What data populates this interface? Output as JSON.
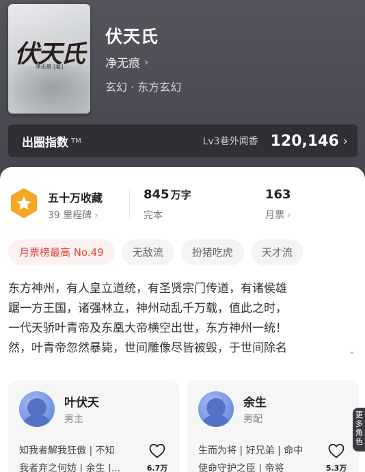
{
  "book": {
    "cover_title": "伏天氏",
    "cover_author": "净无痕 [著]",
    "title": "伏天氏",
    "author": "净无痕",
    "genre": "玄幻 · 东方玄幻"
  },
  "index_bar": {
    "label": "出圈指数",
    "tm": "TM",
    "level": "Lv3巷外闻香",
    "value": "120,146"
  },
  "stats": {
    "collection": {
      "title": "五十万收藏",
      "sub": "39 里程碑"
    },
    "words": {
      "value": "845",
      "unit": "万字",
      "sub": "完本"
    },
    "monthly": {
      "value": "163",
      "sub": "月票"
    }
  },
  "tags": [
    "月票榜最高 No.49",
    "无敌流",
    "扮猪吃虎",
    "天才流"
  ],
  "synopsis": {
    "lines": [
      "东方神州，有人皇立道统，有圣贤宗门传道，有诸侯雄",
      "踞一方王国，诸强林立，神州动乱千万载，值此之时，",
      "一代天骄叶青帝及东凰大帝横空出世，东方神州一统！",
      "然，叶青帝忽然暴毙，世间雕像尽皆被毁，于世间除名"
    ],
    "expand_icon": "chevron-down-icon"
  },
  "characters": [
    {
      "name": "叶伏天",
      "role": "男主",
      "desc_lines": [
        "知我者解我狂傲 | 不知",
        "我者弃之何妨 | 余生 |..."
      ],
      "likes": "6.7万"
    },
    {
      "name": "余生",
      "role": "男配",
      "desc_lines": [
        "生而为将 | 好兄弟 | 命中",
        "使命守护之臣 | 帝将"
      ],
      "likes": "5.3万"
    }
  ],
  "side_tab": {
    "label": "更多角色"
  },
  "colors": {
    "header_bg": "#4b4b53",
    "index_bar_bg": "#2f2f35",
    "badge_orange": "#f5a623",
    "hot_tag_text": "#e0473c",
    "avatar_blue": "#6d8fe0"
  }
}
